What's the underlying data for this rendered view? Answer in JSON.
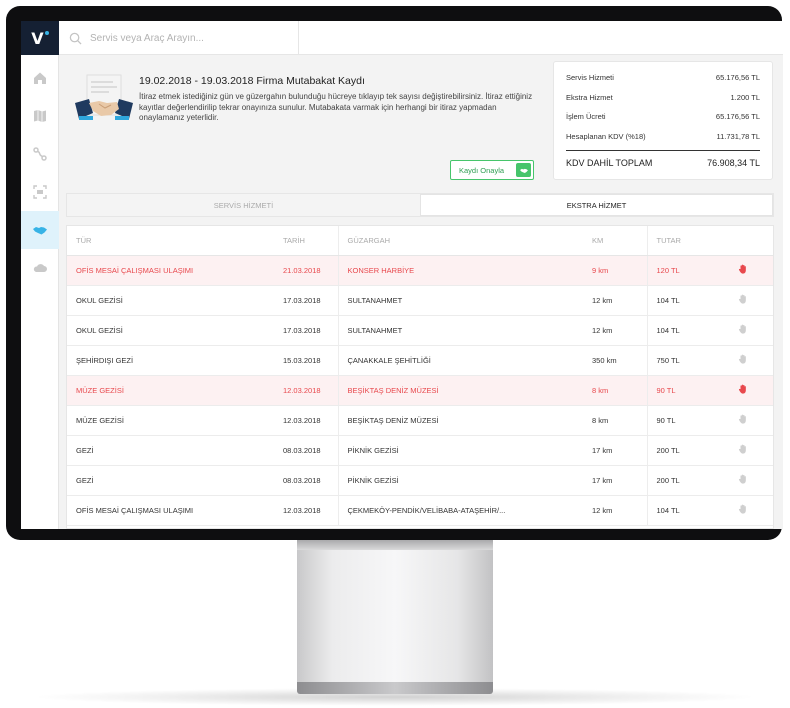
{
  "app": {
    "logo_letter": "V"
  },
  "search": {
    "placeholder": "Servis veya Araç Arayın..."
  },
  "sidebar": {
    "items": [
      {
        "name": "home",
        "active": false
      },
      {
        "name": "map",
        "active": false
      },
      {
        "name": "route",
        "active": false
      },
      {
        "name": "scan",
        "active": false
      },
      {
        "name": "handshake",
        "active": true
      },
      {
        "name": "cloud",
        "active": false
      }
    ]
  },
  "info": {
    "title": "19.02.2018 - 19.03.2018 Firma Mutabakat Kaydı",
    "text": "İtiraz etmek istediğiniz gün ve güzergahın bulunduğu hücreye tıklayıp tek sayısı değiştirebilirsiniz. İtiraz ettiğiniz kayıtlar değerlendirilip tekrar onayınıza sunulur. Mutabakata varmak için herhangi bir itiraz yapmadan onaylamanız yeterlidir.",
    "confirm_label": "Kaydı Onayla"
  },
  "summary": {
    "rows": [
      {
        "label": "Servis Hizmeti",
        "value": "65.176,56 TL"
      },
      {
        "label": "Ekstra Hizmet",
        "value": "1.200 TL"
      },
      {
        "label": "İşlem Ücreti",
        "value": "65.176,56 TL"
      },
      {
        "label": "Hesaplanan KDV (%18)",
        "value": "11.731,78 TL"
      }
    ],
    "total_label": "KDV DAHİL TOPLAM",
    "total_value": "76.908,34 TL"
  },
  "tabs": [
    {
      "label": "SERVİS HİZMETİ",
      "active": false
    },
    {
      "label": "EKSTRA HİZMET",
      "active": true
    }
  ],
  "table": {
    "headers": {
      "type": "TÜR",
      "date": "TARİH",
      "route": "GÜZARGAH",
      "km": "KM",
      "amount": "TUTAR"
    },
    "rows": [
      {
        "type": "OFİS MESAİ ÇALIŞMASI ULAŞIMI",
        "date": "21.03.2018",
        "route": "KONSER HARBİYE",
        "km": "9 km",
        "amount": "120 TL",
        "disputed": true
      },
      {
        "type": "OKUL GEZİSİ",
        "date": "17.03.2018",
        "route": "SULTANAHMET",
        "km": "12 km",
        "amount": "104 TL",
        "disputed": false
      },
      {
        "type": "OKUL GEZİSİ",
        "date": "17.03.2018",
        "route": "SULTANAHMET",
        "km": "12 km",
        "amount": "104 TL",
        "disputed": false
      },
      {
        "type": "ŞEHİRDIŞI GEZİ",
        "date": "15.03.2018",
        "route": "ÇANAKKALE ŞEHİTLİĞİ",
        "km": "350 km",
        "amount": "750 TL",
        "disputed": false
      },
      {
        "type": "MÜZE GEZİSİ",
        "date": "12.03.2018",
        "route": "BEŞİKTAŞ DENİZ MÜZESİ",
        "km": "8 km",
        "amount": "90 TL",
        "disputed": true
      },
      {
        "type": "MÜZE GEZİSİ",
        "date": "12.03.2018",
        "route": "BEŞİKTAŞ DENİZ MÜZESİ",
        "km": "8 km",
        "amount": "90 TL",
        "disputed": false
      },
      {
        "type": "GEZİ",
        "date": "08.03.2018",
        "route": "PİKNİK GEZİSİ",
        "km": "17 km",
        "amount": "200 TL",
        "disputed": false
      },
      {
        "type": "GEZİ",
        "date": "08.03.2018",
        "route": "PİKNİK GEZİSİ",
        "km": "17 km",
        "amount": "200 TL",
        "disputed": false
      },
      {
        "type": "OFİS MESAİ ÇALIŞMASI ULAŞIMI",
        "date": "12.03.2018",
        "route": "ÇEKMEKÖY-PENDİK/VELİBABA-ATAŞEHİR/...",
        "km": "12 km",
        "amount": "104 TL",
        "disputed": false
      }
    ]
  },
  "colors": {
    "accent": "#37b3e6",
    "confirm": "#46c56b",
    "error": "#e8484d",
    "error_bg": "#fdf1f2",
    "sidebar_logo_bg": "#152033"
  }
}
